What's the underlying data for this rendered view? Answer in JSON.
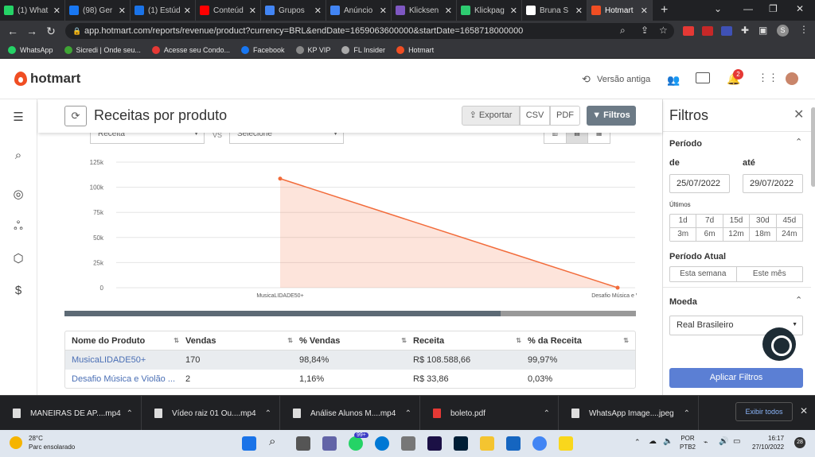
{
  "browser": {
    "tabs": [
      {
        "title": "(1) What",
        "color": "#25d366"
      },
      {
        "title": "(98) Ger",
        "color": "#1877f2"
      },
      {
        "title": "(1) Estúd",
        "color": "#1a73e8"
      },
      {
        "title": "Conteúd",
        "color": "#ff0000"
      },
      {
        "title": "Grupos",
        "color": "#4285f4"
      },
      {
        "title": "Anúncio",
        "color": "#4285f4"
      },
      {
        "title": "Klicksen",
        "color": "#7e57c2"
      },
      {
        "title": "Klickpag",
        "color": "#2ecc71"
      },
      {
        "title": "Bruna S",
        "color": "#ffffff"
      },
      {
        "title": "Hotmart",
        "color": "#f04e23"
      }
    ],
    "url": "app.hotmart.com/reports/revenue/product?currency=BRL&endDate=1659063600000&startDate=1658718000000",
    "bookmarks": [
      {
        "label": "WhatsApp",
        "color": "#25d366"
      },
      {
        "label": "Sicredi | Onde seu...",
        "color": "#3fa535"
      },
      {
        "label": "Acesse seu Condo...",
        "color": "#e53935"
      },
      {
        "label": "Facebook",
        "color": "#1877f2"
      },
      {
        "label": "KP VIP",
        "color": "#888888"
      },
      {
        "label": "FL Insider",
        "color": "#aaaaaa"
      },
      {
        "label": "Hotmart",
        "color": "#f04e23"
      }
    ]
  },
  "header": {
    "logo": "hotmart",
    "old_version": "Versão antiga",
    "notif_count": "2"
  },
  "page": {
    "title": "Receitas por produto",
    "export_label": "Exportar",
    "csv_label": "CSV",
    "pdf_label": "PDF",
    "filters_label": "Filtros",
    "select1": "Receita",
    "vs": "VS",
    "select2": "Selecione"
  },
  "chart_data": {
    "type": "area",
    "categories": [
      "MusicaLIDADE50+",
      "Desafio Música e Violão"
    ],
    "values": [
      108588.66,
      33.86
    ],
    "ylim": [
      0,
      125000
    ],
    "yticks": [
      "0",
      "25k",
      "50k",
      "75k",
      "100k",
      "125k"
    ],
    "xtick_labels": [
      "MusicaLIDADE50+",
      "Desafio Música e Vio"
    ],
    "color": "#f26b3a",
    "grid": true
  },
  "table": {
    "headers": [
      "Nome do Produto",
      "Vendas",
      "% Vendas",
      "Receita",
      "% da Receita"
    ],
    "rows": [
      [
        "MusicaLIDADE50+",
        "170",
        "98,84%",
        "R$ 108.588,66",
        "99,97%"
      ],
      [
        "Desafio Música e Violão ...",
        "2",
        "1,16%",
        "R$ 33,86",
        "0,03%"
      ]
    ]
  },
  "filters": {
    "title": "Filtros",
    "periodo": "Período",
    "de": "de",
    "ate": "até",
    "from": "25/07/2022",
    "to": "29/07/2022",
    "ultimos": "Últimos",
    "ranges": [
      "1d",
      "7d",
      "15d",
      "30d",
      "45d",
      "3m",
      "6m",
      "12m",
      "18m",
      "24m"
    ],
    "periodo_atual": "Período Atual",
    "esta_semana": "Esta semana",
    "este_mes": "Este mês",
    "moeda": "Moeda",
    "currency": "Real Brasileiro",
    "apply": "Aplicar Filtros"
  },
  "downloads": {
    "items": [
      "MANEIRAS DE AP....mp4",
      "Vídeo raiz 01  Ou....mp4",
      "Análise Alunos M....mp4",
      "boleto.pdf",
      "WhatsApp Image....jpeg"
    ],
    "show_all": "Exibir todos"
  },
  "taskbar": {
    "temp": "28°C",
    "weather": "Parc ensolarado",
    "lang1": "POR",
    "lang2": "PTB2",
    "time": "16:17",
    "date": "27/10/2022",
    "notif": "28",
    "badge": "99+"
  }
}
